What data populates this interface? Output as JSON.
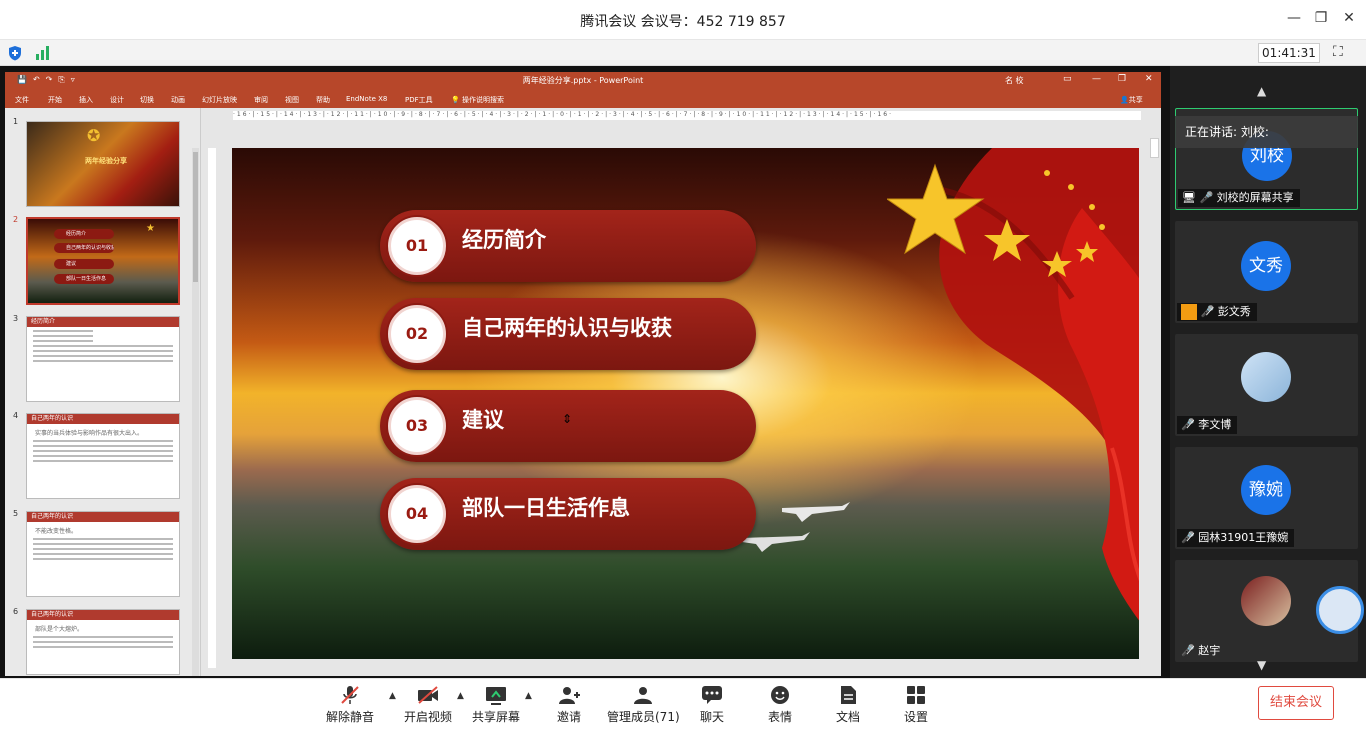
{
  "window": {
    "title": "腾讯会议 会议号：452 719 857"
  },
  "status": {
    "timer": "01:41:31"
  },
  "ppt": {
    "file_title": "两年经验分享.pptx - PowerPoint",
    "user": "名 校",
    "menu": [
      "文件",
      "开始",
      "插入",
      "设计",
      "切换",
      "动画",
      "幻灯片放映",
      "审阅",
      "视图",
      "帮助",
      "EndNote X8",
      "PDF工具",
      "操作说明搜索"
    ],
    "share_label": "共享",
    "thumbnails": [
      {
        "num": "1",
        "title": "两年经验分享"
      },
      {
        "num": "2",
        "items": [
          "经历简介",
          "自己两年的认识与收获",
          "建议",
          "部队一日生活作息"
        ]
      },
      {
        "num": "3",
        "header": "经历简介"
      },
      {
        "num": "4",
        "header": "自己两年的认识",
        "sub": "实事的当兵体验与影响作品有很大出入。"
      },
      {
        "num": "5",
        "header": "自己两年的认识",
        "sub": "不能改变性格。"
      },
      {
        "num": "6",
        "header": "自己两年的认识",
        "sub": "部队是个大熔炉。"
      }
    ],
    "ruler_text": "·16·|·15·|·14·|·13·|·12·|·11·|·10·|·9·|·8·|·7·|·6·|·5·|·4·|·3·|·2·|·1·|·0·|·1·|·2·|·3·|·4·|·5·|·6·|·7·|·8·|·9·|·10·|·11·|·12·|·13·|·14·|·15·|·16·",
    "slide": {
      "items": [
        {
          "num": "01",
          "text": "经历简介"
        },
        {
          "num": "02",
          "text": "自己两年的认识与收获"
        },
        {
          "num": "03",
          "text": "建议"
        },
        {
          "num": "04",
          "text": "部队一日生活作息"
        }
      ]
    }
  },
  "participants": {
    "speaking_label": "正在讲话: 刘校:",
    "tiles": [
      {
        "avatar_text": "刘校",
        "name": "刘校的屏幕共享",
        "active": true
      },
      {
        "avatar_text": "文秀",
        "name": "彭文秀"
      },
      {
        "avatar_text": "",
        "name": "李文博"
      },
      {
        "avatar_text": "豫婉",
        "name": "园林31901王豫婉"
      },
      {
        "avatar_text": "",
        "name": "赵宇"
      }
    ]
  },
  "toolbar": {
    "unmute": "解除静音",
    "video": "开启视频",
    "share": "共享屏幕",
    "invite": "邀请",
    "members": "管理成员(71)",
    "chat": "聊天",
    "reactions": "表情",
    "docs": "文档",
    "settings": "设置",
    "end": "结束会议"
  },
  "colors": {
    "ppt_red": "#b7472a",
    "accent_green": "#2ecc71",
    "end_red": "#e04a3f",
    "avatar_blue": "#1a73e8"
  }
}
